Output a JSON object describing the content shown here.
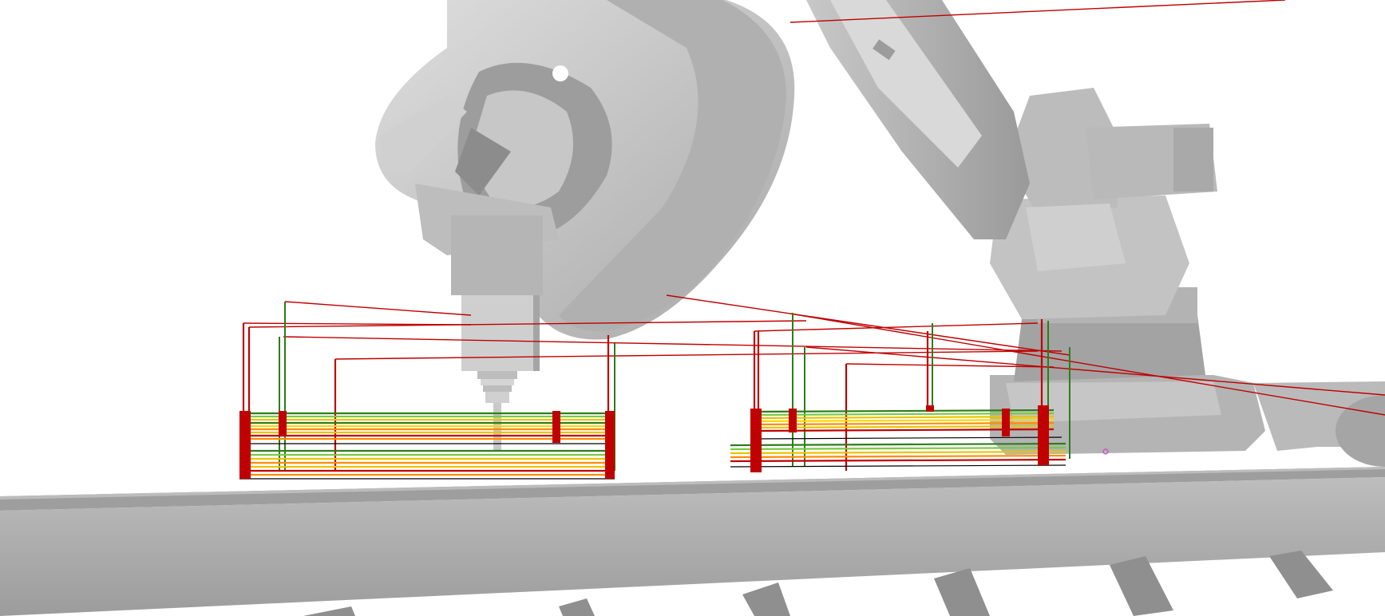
{
  "scene": {
    "background_color": "#ffffff",
    "robot_color": "#c9c9c9",
    "rail_color": "#a9a9a9",
    "toolpath_colors": {
      "move": "#c00000",
      "approach": "#2e7d1a",
      "layer_low": "#e8c400",
      "layer_mid": "#ff8c00",
      "layer_high": "#7ac943"
    }
  }
}
